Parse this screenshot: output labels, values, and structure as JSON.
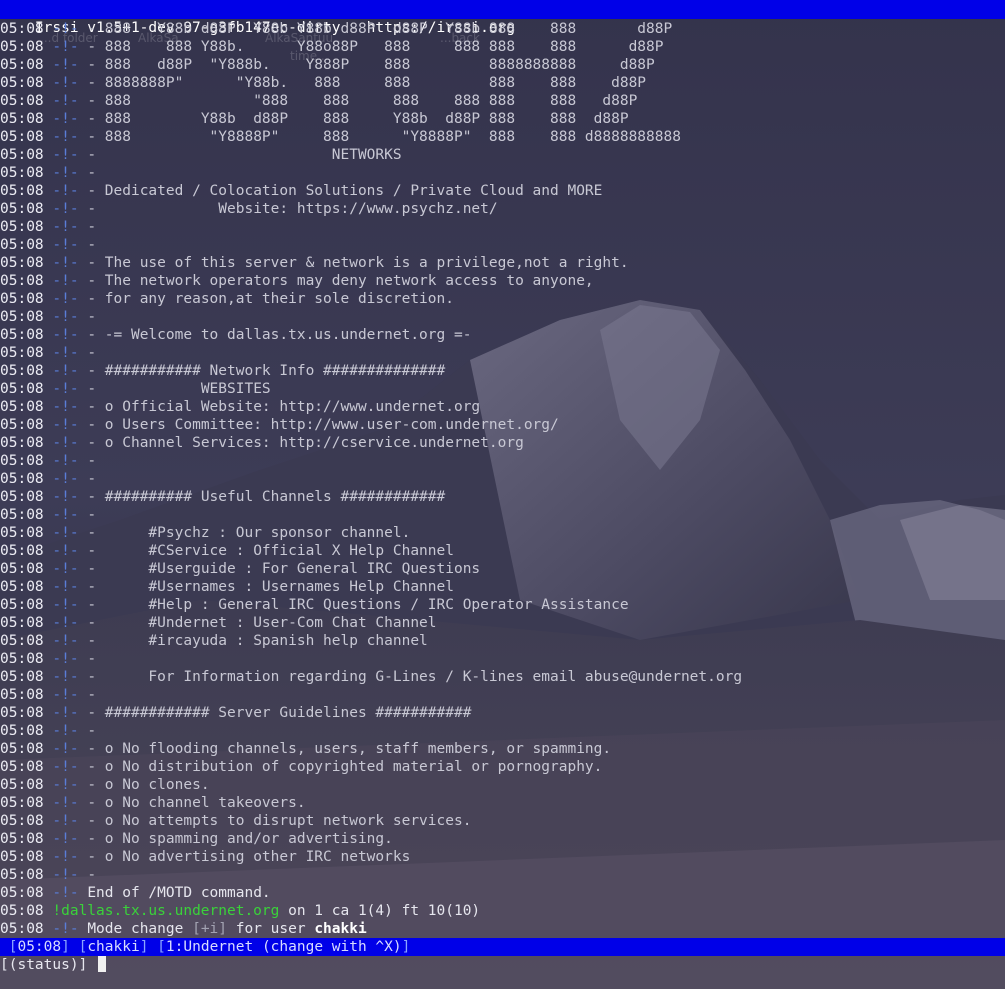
{
  "window": {
    "title": "Irssi v1.5+1-dev-97-g3fb147ec-dirty - https://irssi.org"
  },
  "palette": {
    "titlebar_bg": "#0000e8",
    "timestamp": "#ececf4",
    "prefix": "#5a7dd8",
    "server_green": "#3ad23a"
  },
  "timestamp": "05:08",
  "prefix": "-!-",
  "motd_lines": [
    "- 888   Y88b d88P  Y88b Y88b d88P  d88P  Y88b 888    888       d88P",
    "- 888    888 Y88b.      Y88o88P   888     888 888    888      d88P",
    "- 888   d88P  \"Y888b.    Y888P    888         8888888888     d88P",
    "- 8888888P\"      \"Y88b.   888     888         888    888    d88P",
    "- 888              \"888    888     888    888 888    888   d88P",
    "- 888        Y88b  d88P    888     Y88b  d88P 888    888  d88P",
    "- 888         \"Y8888P\"     888      \"Y8888P\"  888    888 d8888888888",
    "-                           NETWORKS",
    "-",
    "- Dedicated / Colocation Solutions / Private Cloud and MORE",
    "-              Website: https://www.psychz.net/",
    "-",
    "-",
    "- The use of this server & network is a privilege,not a right.",
    "- The network operators may deny network access to anyone,",
    "- for any reason,at their sole discretion.",
    "-",
    "- -= Welcome to dallas.tx.us.undernet.org =-",
    "-",
    "- ########### Network Info ##############",
    "-            WEBSITES",
    "- o Official Website: http://www.undernet.org",
    "- o Users Committee: http://www.user-com.undernet.org/",
    "- o Channel Services: http://cservice.undernet.org",
    "-",
    "-",
    "- ########## Useful Channels ############",
    "-",
    "-      #Psychz : Our sponsor channel.",
    "-      #CService : Official X Help Channel",
    "-      #Userguide : For General IRC Questions",
    "-      #Usernames : Usernames Help Channel",
    "-      #Help : General IRC Questions / IRC Operator Assistance",
    "-      #Undernet : User-Com Chat Channel",
    "-      #ircayuda : Spanish help channel",
    "-",
    "-      For Information regarding G-Lines / K-lines email abuse@undernet.org",
    "-",
    "- ############ Server Guidelines ###########",
    "-",
    "- o No flooding channels, users, staff members, or spamming.",
    "- o No distribution of copyrighted material or pornography.",
    "- o No clones.",
    "- o No channel takeovers.",
    "- o No attempts to disrupt network services.",
    "- o No spamming and/or advertising.",
    "- o No advertising other IRC networks",
    "-"
  ],
  "end_line": "End of /MOTD command.",
  "server_line": {
    "server": "!dallas.tx.us.undernet.org",
    "text": " on 1 ca 1(4) ft 10(10)"
  },
  "mode_line": {
    "text": "Mode change ",
    "mode": "[+i]",
    "middle": " for user ",
    "user": "chakki"
  },
  "statusbar": {
    "time": "05:08",
    "nick": "chakki",
    "window": "1:Undernet (change with ^X)"
  },
  "input": {
    "prompt": "[(status)]"
  },
  "desktop_ghost": [
    "...d folder",
    "AlkaSa...",
    "AlkaSantuu...",
    "...back",
    "time..."
  ]
}
